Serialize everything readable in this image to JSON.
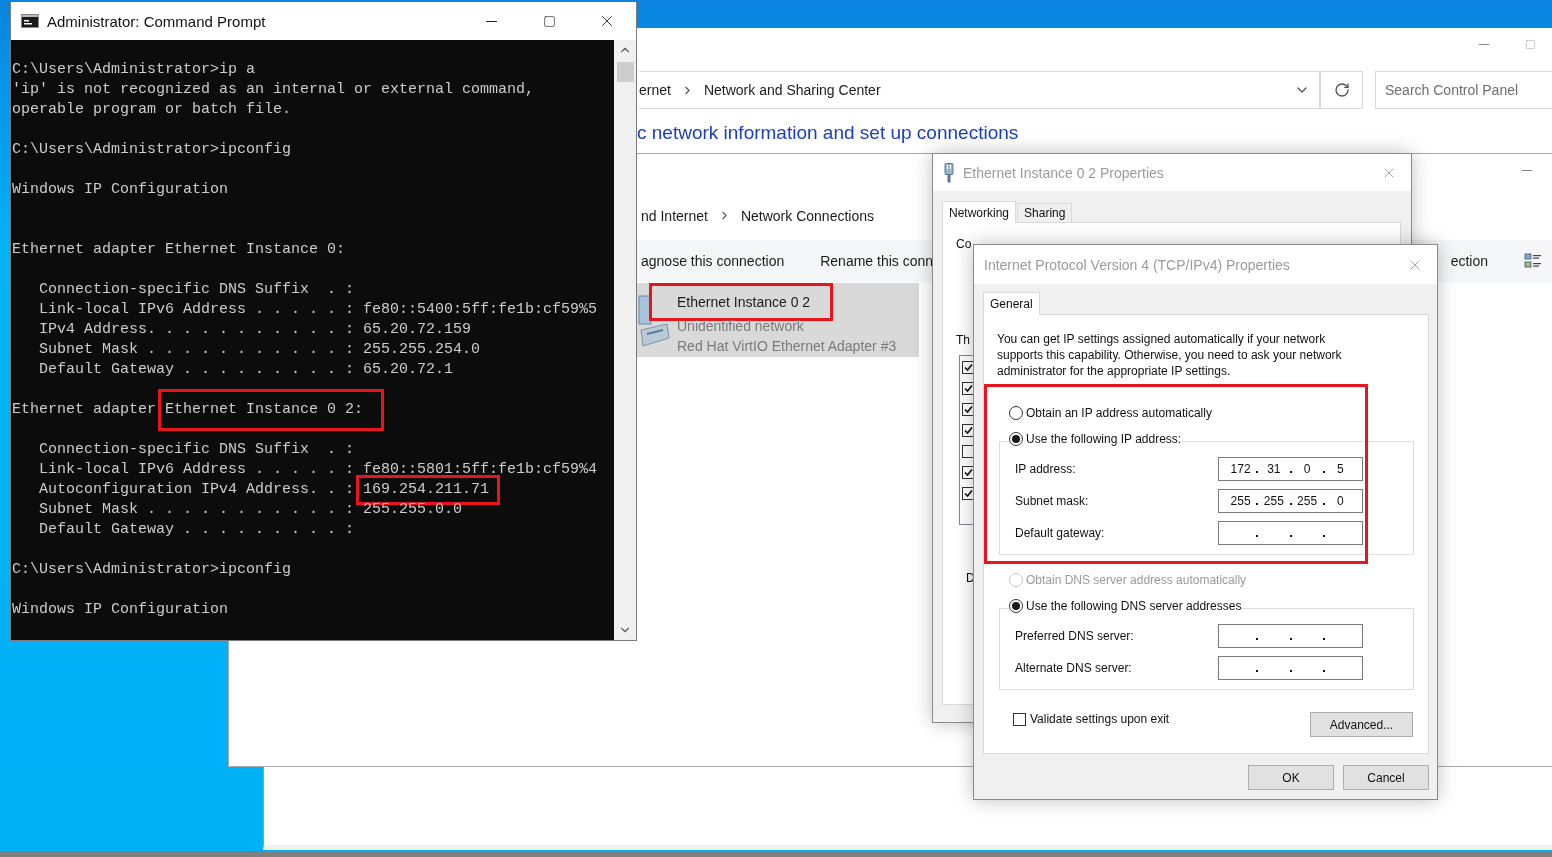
{
  "control_panel": {
    "address_path": [
      "ernet",
      "Network and Sharing Center"
    ],
    "search": {
      "placeholder": "Search Control Panel"
    },
    "heading": "c network information and set up connections"
  },
  "network_connections": {
    "breadcrumb": [
      "nd Internet",
      "Network Connections"
    ],
    "toolbar": [
      "agnose this connection",
      "Rename this conn",
      "ection"
    ],
    "connection": {
      "name": "Ethernet Instance 0 2",
      "highlighted": true,
      "selected": true,
      "status": "Unidentified network",
      "device": "Red Hat VirtIO Ethernet Adapter #3"
    }
  },
  "ethernet_properties": {
    "title": "Ethernet Instance 0 2 Properties",
    "tabs": [
      {
        "label": "Networking",
        "selected": true
      },
      {
        "label": "Sharing",
        "selected": false
      }
    ],
    "connect_label": "Co",
    "items_label": "Th",
    "items": [
      {
        "checked": true
      },
      {
        "checked": true
      },
      {
        "checked": true
      },
      {
        "checked": true
      },
      {
        "checked": false
      },
      {
        "checked": true
      },
      {
        "checked": true
      }
    ],
    "group_label": "D"
  },
  "ipv4_properties": {
    "title": "Internet Protocol Version 4 (TCP/IPv4) Properties",
    "tabs": [
      {
        "label": "General",
        "selected": true
      }
    ],
    "description": "You can get IP settings assigned automatically if your network supports this capability. Otherwise, you need to ask your network administrator for the appropriate IP settings.",
    "ip_settings": {
      "highlighted": true,
      "options": [
        {
          "label": "Obtain an IP address automatically",
          "selected": false,
          "disabled": false
        },
        {
          "label": "Use the following IP address:",
          "selected": true,
          "disabled": false
        }
      ],
      "fields": [
        {
          "label": "IP address:",
          "octets": [
            "172",
            "31",
            "0",
            "5"
          ]
        },
        {
          "label": "Subnet mask:",
          "octets": [
            "255",
            "255",
            "255",
            "0"
          ]
        },
        {
          "label": "Default gateway:"
        }
      ]
    },
    "dns_settings": {
      "options": [
        {
          "label": "Obtain DNS server address automatically",
          "selected": false,
          "disabled": true
        },
        {
          "label": "Use the following DNS server addresses",
          "selected": true,
          "disabled": false
        }
      ],
      "fields": [
        {
          "label": "Preferred DNS server:"
        },
        {
          "label": "Alternate DNS server:"
        }
      ]
    },
    "validate": {
      "label": "Validate settings upon exit",
      "checked": false
    },
    "advanced_button": "Advanced...",
    "buttons": [
      "OK",
      "Cancel"
    ]
  },
  "command_prompt": {
    "title": "Administrator: Command Prompt",
    "lines": [
      {
        "kind": "text",
        "segments": [
          {
            "text": "C:\\Users\\Administrator>ip a",
            "highlighted": false
          }
        ]
      },
      {
        "kind": "text",
        "segments": [
          {
            "text": "'ip' is not recognized as an internal or external command,",
            "highlighted": false
          }
        ]
      },
      {
        "kind": "text",
        "segments": [
          {
            "text": "operable program or batch file.",
            "highlighted": false
          }
        ]
      },
      {
        "kind": "blank"
      },
      {
        "kind": "text",
        "segments": [
          {
            "text": "C:\\Users\\Administrator>ipconfig",
            "highlighted": false
          }
        ]
      },
      {
        "kind": "blank"
      },
      {
        "kind": "text",
        "segments": [
          {
            "text": "Windows IP Configuration",
            "highlighted": false
          }
        ]
      },
      {
        "kind": "blank"
      },
      {
        "kind": "blank"
      },
      {
        "kind": "text",
        "segments": [
          {
            "text": "Ethernet adapter Ethernet Instance 0:",
            "highlighted": false
          }
        ]
      },
      {
        "kind": "blank"
      },
      {
        "kind": "text",
        "segments": [
          {
            "text": "   Connection-specific DNS Suffix  . :",
            "highlighted": false
          }
        ]
      },
      {
        "kind": "text",
        "segments": [
          {
            "text": "   Link-local IPv6 Address . . . . . : fe80::5400:5ff:fe1b:cf59%5",
            "highlighted": false
          }
        ]
      },
      {
        "kind": "text",
        "segments": [
          {
            "text": "   IPv4 Address. . . . . . . . . . . : 65.20.72.159",
            "highlighted": false
          }
        ]
      },
      {
        "kind": "text",
        "segments": [
          {
            "text": "   Subnet Mask . . . . . . . . . . . : 255.255.254.0",
            "highlighted": false
          }
        ]
      },
      {
        "kind": "text",
        "segments": [
          {
            "text": "   Default Gateway . . . . . . . . . : 65.20.72.1",
            "highlighted": false
          }
        ]
      },
      {
        "kind": "blank"
      },
      {
        "kind": "text",
        "segments": [
          {
            "text": "Ethernet adapter ",
            "highlighted": false
          },
          {
            "text": "Ethernet Instance 0 2:",
            "highlighted": true
          }
        ]
      },
      {
        "kind": "blank"
      },
      {
        "kind": "text",
        "segments": [
          {
            "text": "   Connection-specific DNS Suffix  . :",
            "highlighted": false
          }
        ]
      },
      {
        "kind": "text",
        "segments": [
          {
            "text": "   Link-local IPv6 Address . . . . . : fe80::5801:5ff:fe1b:cf59%4",
            "highlighted": false
          }
        ]
      },
      {
        "kind": "text",
        "segments": [
          {
            "text": "   Autoconfiguration IPv4 Address. . : ",
            "highlighted": false
          },
          {
            "text": "169.254.211.71",
            "highlighted": true
          }
        ]
      },
      {
        "kind": "text",
        "segments": [
          {
            "text": "   Subnet Mask . . . . . . . . . . . : 255.255.0.0",
            "highlighted": false
          }
        ]
      },
      {
        "kind": "text",
        "segments": [
          {
            "text": "   Default Gateway . . . . . . . . . :",
            "highlighted": false
          }
        ]
      },
      {
        "kind": "blank"
      },
      {
        "kind": "text",
        "segments": [
          {
            "text": "C:\\Users\\Administrator>ipconfig",
            "highlighted": false
          }
        ]
      },
      {
        "kind": "blank"
      },
      {
        "kind": "text",
        "segments": [
          {
            "text": "Windows IP Configuration",
            "highlighted": false
          }
        ]
      }
    ]
  }
}
